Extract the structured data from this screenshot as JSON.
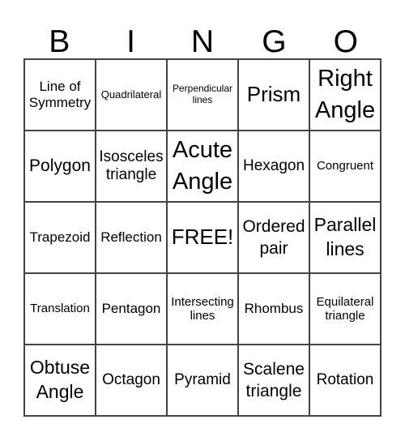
{
  "header": [
    "B",
    "I",
    "N",
    "G",
    "O"
  ],
  "cells": [
    "Line of Symmetry",
    "Quadrilateral",
    "Perpendicular lines",
    "Prism",
    "Right Angle",
    "Polygon",
    "Isosceles triangle",
    "Acute Angle",
    "Hexagon",
    "Congruent",
    "Trapezoid",
    "Reflection",
    "FREE!",
    "Ordered pair",
    "Parallel lines",
    "Translation",
    "Pentagon",
    "Intersecting lines",
    "Rhombus",
    "Equilateral triangle",
    "Obtuse Angle",
    "Octagon",
    "Pyramid",
    "Scalene triangle",
    "Rotation"
  ]
}
